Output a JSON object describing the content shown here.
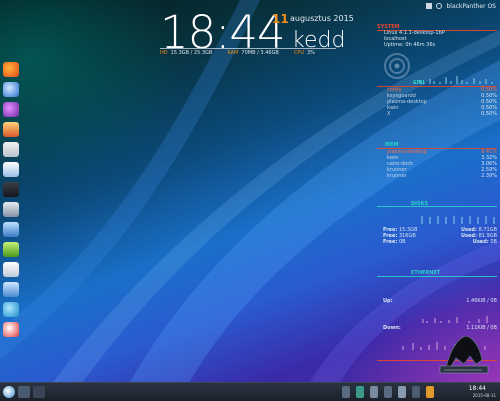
{
  "topbar": {
    "os_label": "blackPanther OS"
  },
  "clock": {
    "time": "18:44",
    "day": "11",
    "month": "augusztus 2015",
    "weekday": "kedd",
    "hd_label": "HD",
    "hd_value": "15.3GB / 25.3GB",
    "ram_label": "RAM",
    "ram_value": "70MB / 3.46GB",
    "cpu_label": "CPU",
    "cpu_value": "3%"
  },
  "system": {
    "title": "SYSTEM",
    "lines": [
      "Linux 4.1.1-desktop-1bP",
      "localhost",
      "Uptime: 0h 46m 36s"
    ]
  },
  "cpu": {
    "title": "CPU",
    "processes": [
      {
        "name": "conky",
        "value": "0.50%"
      },
      {
        "name": "ksysguardd",
        "value": "0.50%"
      },
      {
        "name": "plasma-desktop",
        "value": "0.50%"
      },
      {
        "name": "kwin",
        "value": "0.50%"
      },
      {
        "name": "X",
        "value": "0.50%"
      }
    ]
  },
  "mem": {
    "title": "MEM",
    "processes": [
      {
        "name": "plasma-desktop",
        "value": "8.41%"
      },
      {
        "name": "kwin",
        "value": "3.32%"
      },
      {
        "name": "cairo-dock",
        "value": "3.06%"
      },
      {
        "name": "krunner",
        "value": "2.59%"
      },
      {
        "name": "krunner",
        "value": "2.39%"
      }
    ]
  },
  "disks": {
    "title": "DISKS",
    "rows": [
      {
        "free_label": "Free:",
        "free": "15.3GB",
        "used_label": "Used:",
        "used": "8.71GB"
      },
      {
        "free_label": "Free:",
        "free": "316GB",
        "used_label": "Used:",
        "used": "81.9GB"
      },
      {
        "free_label": "Free:",
        "free": "0B",
        "used_label": "Used:",
        "used": "0B"
      }
    ]
  },
  "ethernet": {
    "title": "ETHERNET",
    "up_label": "Up:",
    "up_value": "1.46KiB / 0B",
    "down_label": "Down:",
    "down_value": "1.11KiB / 0B"
  },
  "taskbar": {
    "time": "18:44",
    "date": "2015-08-11"
  },
  "colors": {
    "accent_red": "#e8462c",
    "accent_teal": "#2ad1c8",
    "accent_orange": "#f08c1a"
  }
}
